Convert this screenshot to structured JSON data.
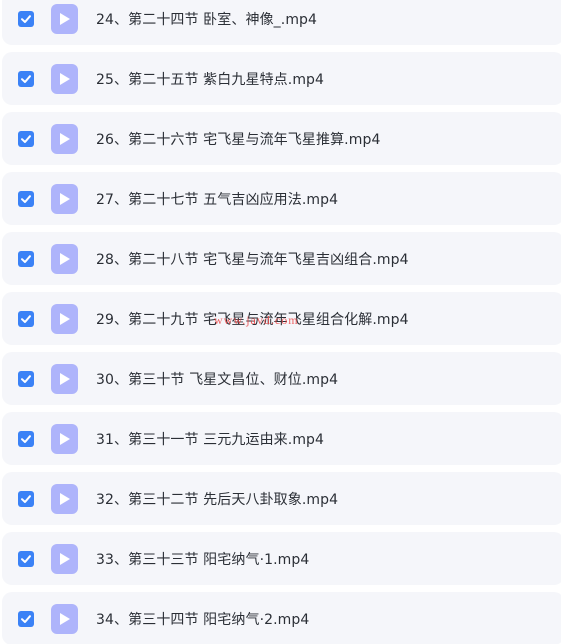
{
  "files": [
    {
      "name": "24、第二十四节 卧室、神像_.mp4",
      "checked": true
    },
    {
      "name": "25、第二十五节 紫白九星特点.mp4",
      "checked": true
    },
    {
      "name": "26、第二十六节 宅飞星与流年飞星推算.mp4",
      "checked": true
    },
    {
      "name": "27、第二十七节 五气吉凶应用法.mp4",
      "checked": true
    },
    {
      "name": "28、第二十八节 宅飞星与流年飞星吉凶组合.mp4",
      "checked": true
    },
    {
      "name": "29、第二十九节 宅飞星与流年飞星组合化解.mp4",
      "checked": true
    },
    {
      "name": "30、第三十节 飞星文昌位、财位.mp4",
      "checked": true
    },
    {
      "name": "31、第三十一节 三元九运由来.mp4",
      "checked": true
    },
    {
      "name": "32、第三十二节 先后天八卦取象.mp4",
      "checked": true
    },
    {
      "name": "33、第三十三节 阳宅纳气·1.mp4",
      "checked": true
    },
    {
      "name": "34、第三十四节 阳宅纳气·2.mp4",
      "checked": true
    }
  ],
  "watermark": "www.javd.com",
  "colors": {
    "row_background": "#f5f6fa",
    "checkbox": "#3b82f6",
    "file_icon": "#aeb4fb",
    "text": "#2b2f36"
  },
  "icons": {
    "checkbox": "check-icon",
    "file": "video-file-icon"
  }
}
